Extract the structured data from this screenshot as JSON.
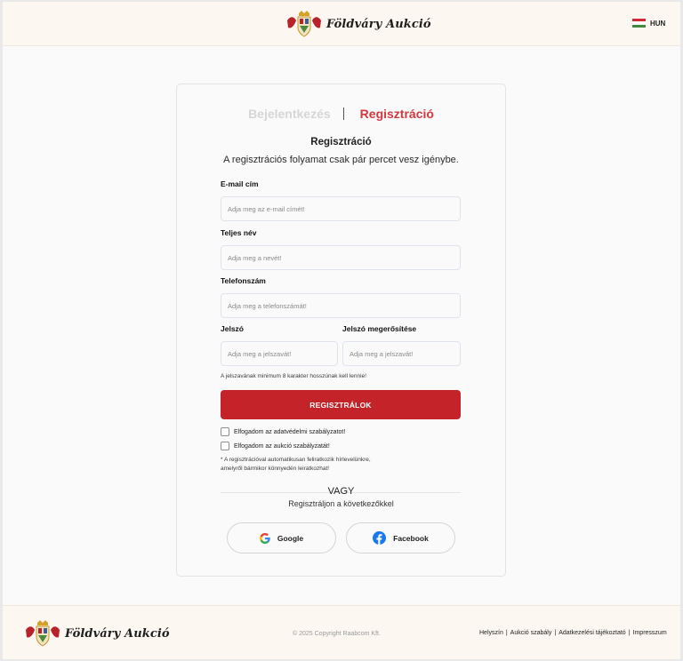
{
  "header": {
    "logo_text": "Földváry Aukció",
    "language": "HUN"
  },
  "tabs": {
    "login": "Bejelentkezés",
    "register": "Regisztráció"
  },
  "form": {
    "title": "Regisztráció",
    "subtitle": "A regisztrációs folyamat csak pár percet vesz igénybe.",
    "email": {
      "label": "E-mail cím",
      "placeholder": "Adja meg az e-mail címét!",
      "value": ""
    },
    "name": {
      "label": "Teljes név",
      "placeholder": "Adja meg a nevét!",
      "value": ""
    },
    "phone": {
      "label": "Telefonszám",
      "placeholder": "Adja meg a telefonszámát!",
      "value": ""
    },
    "password": {
      "label": "Jelszó",
      "placeholder": "Adja meg a jelszavát!",
      "value": ""
    },
    "password_confirm": {
      "label": "Jelszó megerősítése",
      "placeholder": "Adja meg a jelszavát!",
      "value": ""
    },
    "password_hint": "A jelszavának minimum 8 karakter hosszúnak kell lennie!",
    "submit_label": "REGISZTRÁLOK",
    "accept_privacy": "Elfogadom az adatvédelmi szabályzatot!",
    "accept_auction": "Elfogadom az aukció szabályzatát!",
    "note_line1": "* A regisztrációval automatikusan feliratkozik hírlevelünkre,",
    "note_line2": "amelyről bármikor könnyedén leiratkozhat!",
    "or_label": "VAGY",
    "social_hint": "Regisztráljon a következőkkel",
    "google_label": "Google",
    "facebook_label": "Facebook"
  },
  "footer": {
    "logo_text": "Földváry Aukció",
    "copyright": "© 2025 Copyright Raabcom Kft.",
    "links": [
      "Helyszín",
      "Aukció szabály",
      "Adatkezelési tájékoztató",
      "Impresszum"
    ],
    "separator": "|"
  },
  "colors": {
    "brand_red": "#c4232a",
    "tab_active": "#d0383e",
    "tab_inactive": "#d6d6d6",
    "cream": "#fcf8f1"
  }
}
